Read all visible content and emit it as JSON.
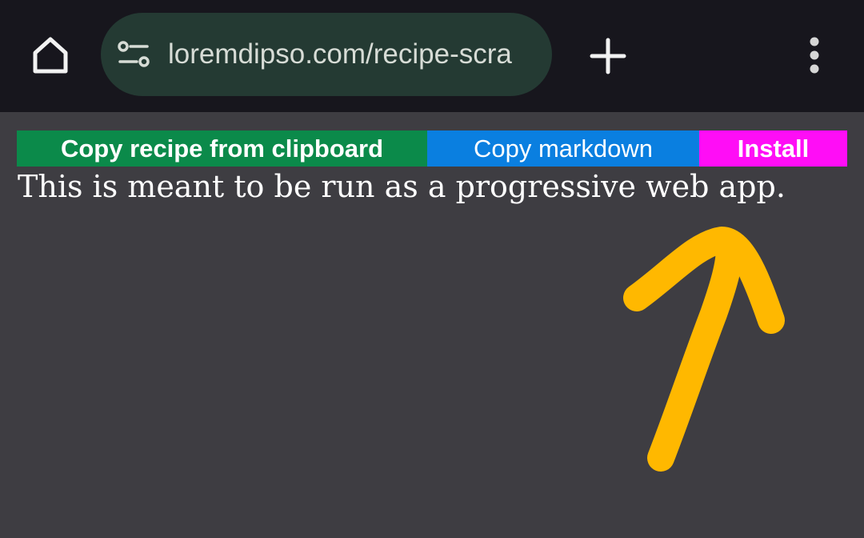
{
  "browser": {
    "url": "loremdipso.com/recipe-scra",
    "icons": {
      "home": "home-icon",
      "site_settings": "tune-icon",
      "new_tab": "plus-icon",
      "menu": "more-vert-icon"
    }
  },
  "page": {
    "buttons": {
      "copy_recipe": "Copy recipe from clipboard",
      "copy_markdown": "Copy markdown",
      "install": "Install"
    },
    "message": "This is meant to be run as a progressive web app."
  },
  "colors": {
    "toolbar_bg": "#17161d",
    "urlbar_bg": "#243a33",
    "page_bg": "#3e3d42",
    "copy_recipe_bg": "#0b8a4a",
    "copy_markdown_bg": "#0a7fe0",
    "install_bg": "#ff0df6",
    "annotation_arrow": "#ffb800"
  }
}
